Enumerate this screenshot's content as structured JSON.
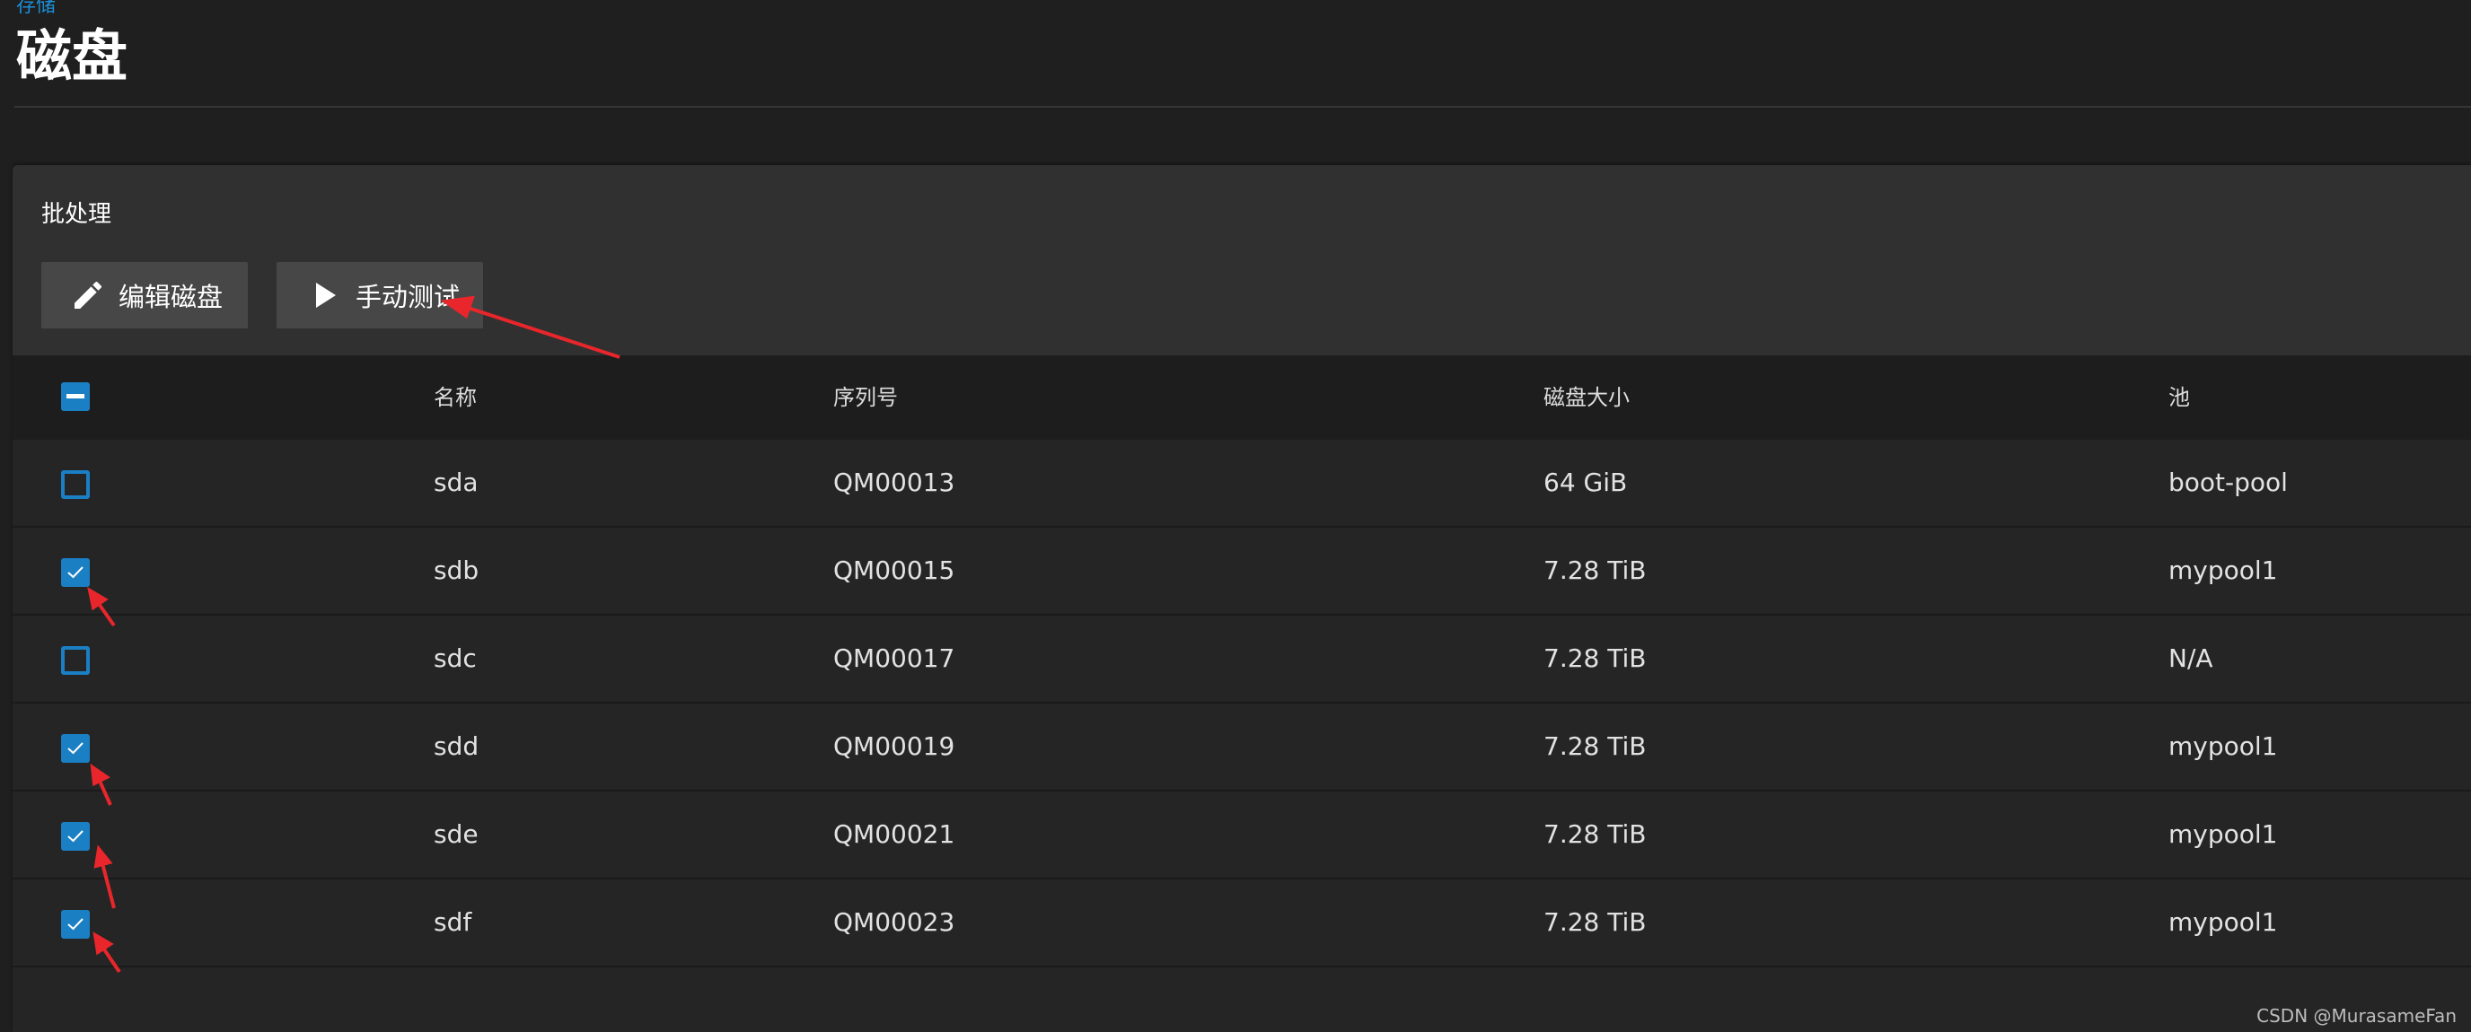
{
  "breadcrumb": "存储",
  "page_title": "磁盘",
  "batch": {
    "title": "批处理",
    "edit_label": "编辑磁盘",
    "test_label": "手动测试"
  },
  "table": {
    "headers": {
      "name": "名称",
      "serial": "序列号",
      "size": "磁盘大小",
      "pool": "池"
    },
    "select_all_state": "indeterminate",
    "rows": [
      {
        "name": "sda",
        "serial": "QM00013",
        "size": "64 GiB",
        "pool": "boot-pool",
        "checked": false
      },
      {
        "name": "sdb",
        "serial": "QM00015",
        "size": "7.28 TiB",
        "pool": "mypool1",
        "checked": true
      },
      {
        "name": "sdc",
        "serial": "QM00017",
        "size": "7.28 TiB",
        "pool": "N/A",
        "checked": false
      },
      {
        "name": "sdd",
        "serial": "QM00019",
        "size": "7.28 TiB",
        "pool": "mypool1",
        "checked": true
      },
      {
        "name": "sde",
        "serial": "QM00021",
        "size": "7.28 TiB",
        "pool": "mypool1",
        "checked": true
      },
      {
        "name": "sdf",
        "serial": "QM00023",
        "size": "7.28 TiB",
        "pool": "mypool1",
        "checked": true
      }
    ]
  },
  "watermark": "CSDN @MurasameFan",
  "colors": {
    "accent": "#1b7fc4",
    "breadcrumb": "#1b8fd6",
    "annotation": "#e8262b"
  },
  "icons": {
    "edit": "pencil-icon",
    "test": "play-icon",
    "check": "checkmark-icon",
    "indeterminate": "minus-icon"
  }
}
